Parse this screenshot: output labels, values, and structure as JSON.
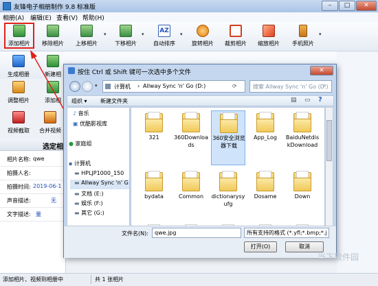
{
  "app": {
    "title": "友锋电子相册制作 9.8 标准版",
    "window_buttons": {
      "minimize": "–",
      "maximize": "□",
      "close": "✕"
    }
  },
  "menu": [
    "相册(A)",
    "编辑(E)",
    "查看(V)",
    "帮助(H)"
  ],
  "toolbar": {
    "buttons": [
      {
        "label": "添加相片",
        "icon": "add-photo-icon"
      },
      {
        "label": "移除相片",
        "icon": "remove-photo-icon"
      },
      {
        "label": "上移相片",
        "icon": "move-up-icon"
      },
      {
        "label": "下移相片",
        "icon": "move-down-icon"
      },
      {
        "label": "自动排序",
        "icon": "auto-sort-icon"
      },
      {
        "label": "旋转相片",
        "icon": "rotate-icon"
      },
      {
        "label": "裁剪相片",
        "icon": "crop-icon"
      },
      {
        "label": "缩放相片",
        "icon": "resize-icon"
      },
      {
        "label": "手机照片",
        "icon": "phone-photo-icon"
      }
    ],
    "dropdown_glyph": "▾"
  },
  "left_toolbar": [
    {
      "label": "生成相册",
      "icon": "generate-album-icon"
    },
    {
      "label": "新建相",
      "icon": "new-album-icon"
    },
    {
      "label": "调整相片",
      "icon": "adjust-photo-icon"
    },
    {
      "label": "添加相",
      "icon": "add-icon"
    },
    {
      "label": "视频截取",
      "icon": "video-capture-icon"
    },
    {
      "label": "合并视频",
      "icon": "merge-video-icon"
    }
  ],
  "left_panel": {
    "header": "选定相",
    "rows": [
      {
        "label": "相片名称:",
        "value": "qwe"
      },
      {
        "label": "拍摄人名:",
        "value": ""
      },
      {
        "label": "拍摄时间:",
        "value": "2019-06-1"
      },
      {
        "label": "声音描述:",
        "value": "无"
      },
      {
        "label": "文字描述:",
        "value": "量"
      }
    ]
  },
  "status": {
    "left": "添加相片、视频到相册中",
    "right": "共 1 张相片"
  },
  "dialog": {
    "title": "按住 Ctrl 或 Shift 键可一次选中多个文件",
    "address": [
      "计算机",
      "Allway Sync 'n' Go (D:)"
    ],
    "search_placeholder": "搜索 Allway Sync 'n' Go (D:)",
    "organize": "组织 ▾",
    "new_folder": "新建文件夹",
    "nav": {
      "favorites": [
        "音乐",
        "优酷影视库"
      ],
      "homegroup": "家庭组",
      "computer": "计算机",
      "drives": [
        "HPLJP1000_150",
        "Allway Sync 'n' G",
        "文档 (E:)",
        "娱乐 (F:)",
        "其它 (G:)"
      ]
    },
    "files": [
      {
        "name": "321",
        "selected": false
      },
      {
        "name": "360Downloads",
        "selected": false
      },
      {
        "name": "360安全浏览器下载",
        "selected": true
      },
      {
        "name": "App_Log",
        "selected": false
      },
      {
        "name": "BaiduNetdiskDownload",
        "selected": false
      },
      {
        "name": "bydata",
        "selected": false
      },
      {
        "name": "Common",
        "selected": false
      },
      {
        "name": "dictionarysyufg",
        "selected": false
      },
      {
        "name": "Dosame",
        "selected": false
      },
      {
        "name": "Down",
        "selected": false
      }
    ],
    "filename_label": "文件名(N):",
    "filename_value": "qwe.jpg",
    "filter_value": "所有支持的格式 (*.yfl;*.bmp;*.j",
    "open_label": "打开(O)",
    "cancel_label": "取消"
  },
  "watermark": "当下软件园"
}
